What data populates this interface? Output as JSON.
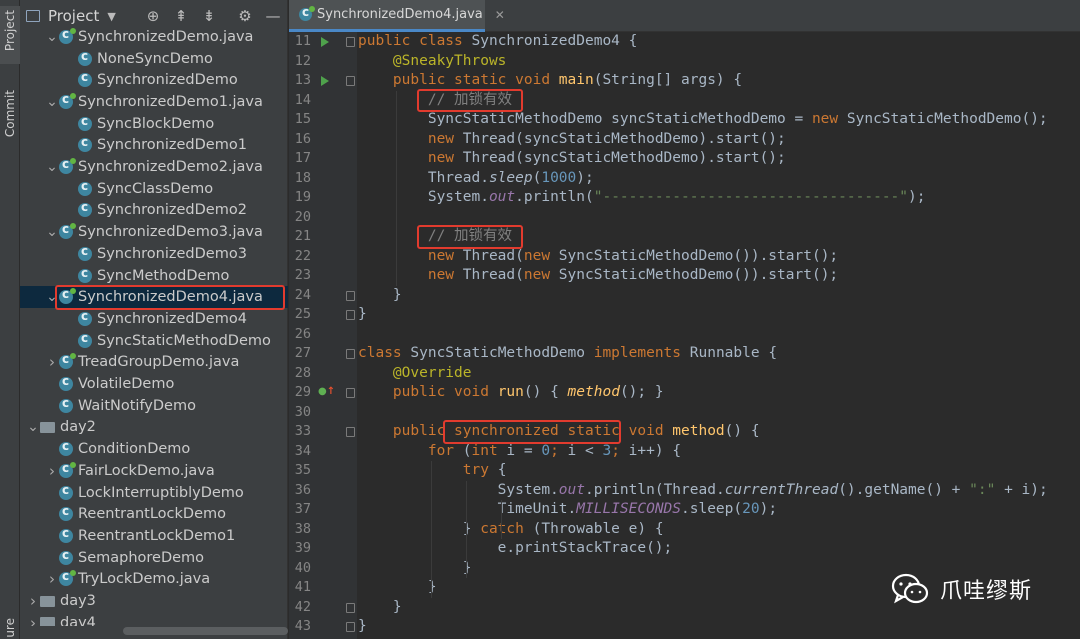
{
  "tool_strip": {
    "project_label": "Project",
    "commit_label": "Commit",
    "structure_label": "ure"
  },
  "project_panel": {
    "title": "Project",
    "tree": [
      {
        "label": "SynchronizedDemo.java",
        "kind": "file",
        "expanded": true
      },
      {
        "label": "NoneSyncDemo",
        "kind": "class"
      },
      {
        "label": "SynchronizedDemo",
        "kind": "class"
      },
      {
        "label": "SynchronizedDemo1.java",
        "kind": "file",
        "expanded": true
      },
      {
        "label": "SyncBlockDemo",
        "kind": "class"
      },
      {
        "label": "SynchronizedDemo1",
        "kind": "class"
      },
      {
        "label": "SynchronizedDemo2.java",
        "kind": "file",
        "expanded": true
      },
      {
        "label": "SyncClassDemo",
        "kind": "class"
      },
      {
        "label": "SynchronizedDemo2",
        "kind": "class"
      },
      {
        "label": "SynchronizedDemo3.java",
        "kind": "file",
        "expanded": true
      },
      {
        "label": "SynchronizedDemo3",
        "kind": "class"
      },
      {
        "label": "SyncMethodDemo",
        "kind": "class"
      },
      {
        "label": "SynchronizedDemo4.java",
        "kind": "file",
        "expanded": true,
        "selected": true
      },
      {
        "label": "SynchronizedDemo4",
        "kind": "class"
      },
      {
        "label": "SyncStaticMethodDemo",
        "kind": "class"
      },
      {
        "label": "TreadGroupDemo.java",
        "kind": "file",
        "expanded": false
      },
      {
        "label": "VolatileDemo",
        "kind": "class"
      },
      {
        "label": "WaitNotifyDemo",
        "kind": "class"
      },
      {
        "label": "day2",
        "kind": "folder",
        "expanded": true
      },
      {
        "label": "ConditionDemo",
        "kind": "class"
      },
      {
        "label": "FairLockDemo.java",
        "kind": "file",
        "expanded": false
      },
      {
        "label": "LockInterruptiblyDemo",
        "kind": "class"
      },
      {
        "label": "ReentrantLockDemo",
        "kind": "class"
      },
      {
        "label": "ReentrantLockDemo1",
        "kind": "class"
      },
      {
        "label": "SemaphoreDemo",
        "kind": "class"
      },
      {
        "label": "TryLockDemo.java",
        "kind": "file",
        "expanded": false
      },
      {
        "label": "day3",
        "kind": "folder",
        "expanded": false
      },
      {
        "label": "day4",
        "kind": "folder",
        "expanded": false
      }
    ]
  },
  "editor_tab": {
    "label": "SynchronizedDemo4.java"
  },
  "editor": {
    "lines": [
      {
        "n": "11",
        "tokens": [
          [
            "kw",
            "public class "
          ],
          [
            "cls",
            "SynchronizedDemo4 {"
          ]
        ]
      },
      {
        "n": "12",
        "tokens": [
          [
            "",
            "    "
          ],
          [
            "ann",
            "@SneakyThrows"
          ]
        ]
      },
      {
        "n": "13",
        "tokens": [
          [
            "",
            "    "
          ],
          [
            "kw",
            "public static void "
          ],
          [
            "fn",
            "main"
          ],
          [
            "",
            "(String[] args) {"
          ]
        ]
      },
      {
        "n": "14",
        "tokens": [
          [
            "",
            "        "
          ],
          [
            "com",
            "// 加锁有效"
          ]
        ]
      },
      {
        "n": "15",
        "tokens": [
          [
            "",
            "        SyncStaticMethodDemo syncStaticMethodDemo = "
          ],
          [
            "kw",
            "new "
          ],
          [
            "",
            "SyncStaticMethodDemo();"
          ]
        ]
      },
      {
        "n": "16",
        "tokens": [
          [
            "",
            "        "
          ],
          [
            "kw",
            "new "
          ],
          [
            "",
            "Thread(syncStaticMethodDemo).start();"
          ]
        ]
      },
      {
        "n": "17",
        "tokens": [
          [
            "",
            "        "
          ],
          [
            "kw",
            "new "
          ],
          [
            "",
            "Thread(syncStaticMethodDemo).start();"
          ]
        ]
      },
      {
        "n": "18",
        "tokens": [
          [
            "",
            "        Thread."
          ],
          [
            "it",
            "sleep"
          ],
          [
            "",
            "("
          ],
          [
            "num",
            "1000"
          ],
          [
            "",
            ");"
          ]
        ]
      },
      {
        "n": "19",
        "tokens": [
          [
            "",
            "        System."
          ],
          [
            "sf",
            "out"
          ],
          [
            "",
            ".println("
          ],
          [
            "str",
            "\"----------------------------------\""
          ],
          [
            "",
            ");"
          ]
        ]
      },
      {
        "n": "20",
        "tokens": [
          [
            "",
            ""
          ]
        ]
      },
      {
        "n": "21",
        "tokens": [
          [
            "",
            "        "
          ],
          [
            "com",
            "// 加锁有效"
          ]
        ]
      },
      {
        "n": "22",
        "tokens": [
          [
            "",
            "        "
          ],
          [
            "kw",
            "new "
          ],
          [
            "",
            "Thread("
          ],
          [
            "kw",
            "new "
          ],
          [
            "",
            "SyncStaticMethodDemo()).start();"
          ]
        ]
      },
      {
        "n": "23",
        "tokens": [
          [
            "",
            "        "
          ],
          [
            "kw",
            "new "
          ],
          [
            "",
            "Thread("
          ],
          [
            "kw",
            "new "
          ],
          [
            "",
            "SyncStaticMethodDemo()).start();"
          ]
        ]
      },
      {
        "n": "24",
        "tokens": [
          [
            "",
            "    }"
          ]
        ]
      },
      {
        "n": "25",
        "tokens": [
          [
            "",
            "}"
          ]
        ]
      },
      {
        "n": "26",
        "tokens": [
          [
            "",
            ""
          ]
        ]
      },
      {
        "n": "27",
        "tokens": [
          [
            "kw",
            "class "
          ],
          [
            "",
            "SyncStaticMethodDemo "
          ],
          [
            "kw",
            "implements "
          ],
          [
            "",
            "Runnable {"
          ]
        ]
      },
      {
        "n": "28",
        "tokens": [
          [
            "",
            "    "
          ],
          [
            "ann",
            "@Override"
          ]
        ]
      },
      {
        "n": "29",
        "tokens": [
          [
            "",
            "    "
          ],
          [
            "kw",
            "public void "
          ],
          [
            "fn",
            "run"
          ],
          [
            "",
            "() { "
          ],
          [
            "mi",
            "method"
          ],
          [
            "",
            "(); }"
          ]
        ]
      },
      {
        "n": "30",
        "tokens": [
          [
            "",
            ""
          ]
        ]
      },
      {
        "n": "33",
        "tokens": [
          [
            "",
            "    "
          ],
          [
            "kw",
            "public synchronized static void "
          ],
          [
            "fn",
            "method"
          ],
          [
            "",
            "() {"
          ]
        ]
      },
      {
        "n": "34",
        "tokens": [
          [
            "",
            "        "
          ],
          [
            "kw",
            "for "
          ],
          [
            "",
            "("
          ],
          [
            "kw",
            "int "
          ],
          [
            "",
            "i = "
          ],
          [
            "num",
            "0"
          ],
          [
            "kw",
            "; "
          ],
          [
            "",
            "i < "
          ],
          [
            "num",
            "3"
          ],
          [
            "kw",
            "; "
          ],
          [
            "",
            "i++) {"
          ]
        ]
      },
      {
        "n": "35",
        "tokens": [
          [
            "",
            "            "
          ],
          [
            "kw",
            "try "
          ],
          [
            "",
            "{"
          ]
        ]
      },
      {
        "n": "36",
        "tokens": [
          [
            "",
            "                System."
          ],
          [
            "sf",
            "out"
          ],
          [
            "",
            ".println(Thread."
          ],
          [
            "it",
            "currentThread"
          ],
          [
            "",
            "().getName() + "
          ],
          [
            "str",
            "\":\""
          ],
          [
            "",
            " + i);"
          ]
        ]
      },
      {
        "n": "37",
        "tokens": [
          [
            "",
            "                TimeUnit."
          ],
          [
            "sf",
            "MILLISECONDS"
          ],
          [
            "",
            ".sleep("
          ],
          [
            "num",
            "20"
          ],
          [
            "",
            ");"
          ]
        ]
      },
      {
        "n": "38",
        "tokens": [
          [
            "",
            "            } "
          ],
          [
            "kw",
            "catch "
          ],
          [
            "",
            "(Throwable e) {"
          ]
        ]
      },
      {
        "n": "39",
        "tokens": [
          [
            "",
            "                e.printStackTrace();"
          ]
        ]
      },
      {
        "n": "40",
        "tokens": [
          [
            "",
            "            }"
          ]
        ]
      },
      {
        "n": "41",
        "tokens": [
          [
            "",
            "        }"
          ]
        ]
      },
      {
        "n": "42",
        "tokens": [
          [
            "",
            "    }"
          ]
        ]
      },
      {
        "n": "43",
        "tokens": [
          [
            "",
            "}"
          ]
        ]
      }
    ]
  },
  "watermark": {
    "text": "爪哇缪斯"
  },
  "colors": {
    "highlight_box": "#e23b2e",
    "selection": "#0d293e",
    "keyword": "#cc7832",
    "string": "#6a8759",
    "number": "#6897bb",
    "annotation": "#bbb529",
    "method_decl": "#ffc66d"
  }
}
